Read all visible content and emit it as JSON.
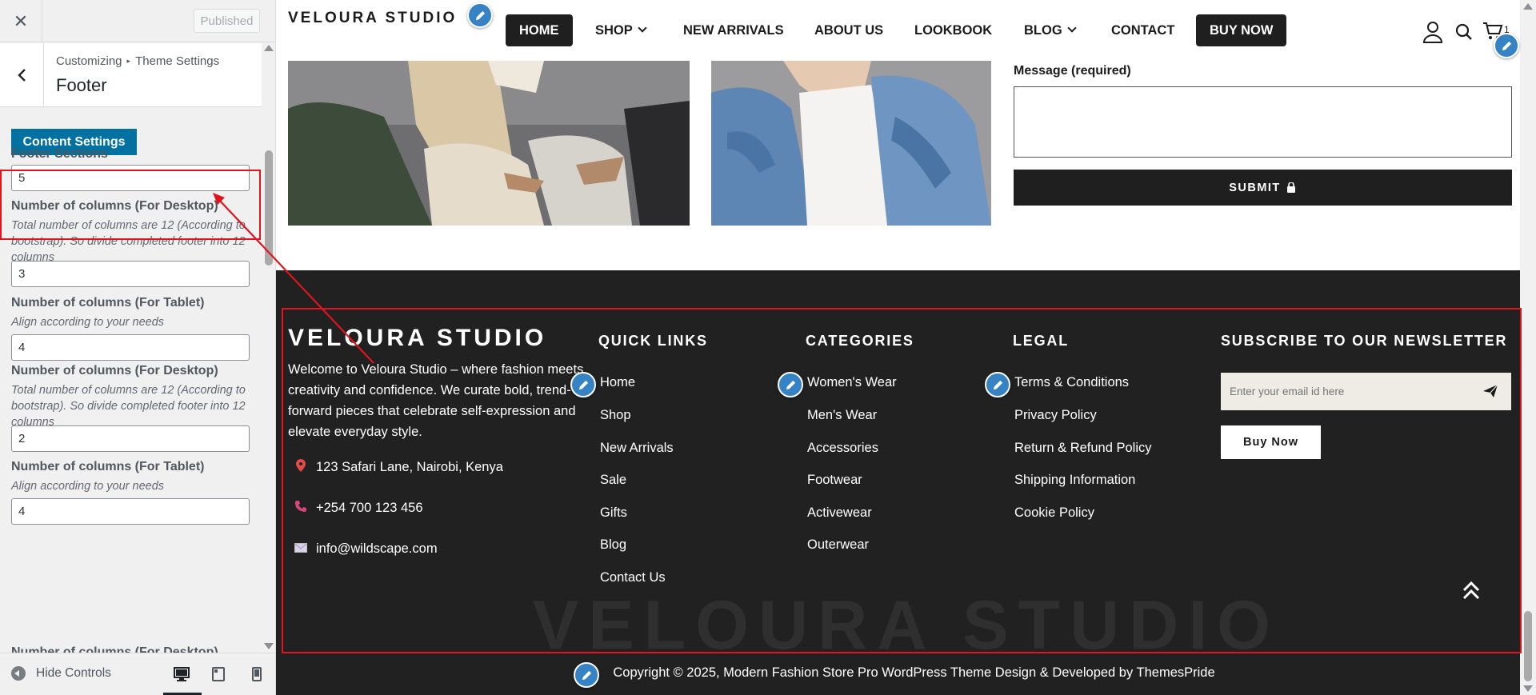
{
  "customizer": {
    "close_icon": "close-icon",
    "published_label": "Published",
    "breadcrumb_root": "Customizing",
    "breadcrumb_parent": "Theme Settings",
    "section_title": "Footer",
    "content_settings_label": "Content Settings",
    "fields": [
      {
        "label": "Footer Sections",
        "description": "",
        "value": "5"
      },
      {
        "label": "Number of columns (For Desktop)",
        "description": "Total number of columns are 12 (According to bootstrap). So divide completed footer into 12 columns",
        "value": "3"
      },
      {
        "label": "Number of columns (For Tablet)",
        "description": "Align according to your needs",
        "value": "4"
      },
      {
        "label": "Number of columns (For Desktop)",
        "description": "Total number of columns are 12 (According to bootstrap). So divide completed footer into 12 columns",
        "value": "2"
      },
      {
        "label": "Number of columns (For Tablet)",
        "description": "Align according to your needs",
        "value": "4"
      },
      {
        "label": "Number of columns (For Desktop)",
        "description": "",
        "value": ""
      }
    ],
    "hide_controls_label": "Hide Controls",
    "devices": [
      "desktop",
      "tablet",
      "mobile"
    ],
    "active_device": "desktop"
  },
  "site": {
    "logo": "VELOURA STUDIO",
    "nav": [
      {
        "label": "HOME",
        "dropdown": false,
        "active": true
      },
      {
        "label": "SHOP",
        "dropdown": true
      },
      {
        "label": "NEW ARRIVALS",
        "dropdown": false
      },
      {
        "label": "ABOUT US",
        "dropdown": false
      },
      {
        "label": "LOOKBOOK",
        "dropdown": false
      },
      {
        "label": "BLOG",
        "dropdown": true
      },
      {
        "label": "CONTACT",
        "dropdown": false
      }
    ],
    "buy_now": "BUY NOW",
    "cart_count": "1",
    "contact_form": {
      "message_label": "Message (required)",
      "submit_label": "SUBMIT"
    }
  },
  "footer": {
    "logo": "VELOURA STUDIO",
    "about": "Welcome to Veloura Studio – where fashion meets creativity and confidence. We curate bold, trend-forward pieces that celebrate self-expression and elevate everyday style.",
    "address": "123 Safari Lane, Nairobi, Kenya",
    "phone": "+254 700 123 456",
    "email": "info@wildscape.com",
    "quick_links": {
      "title": "QUICK LINKS",
      "items": [
        "Home",
        "Shop",
        "New Arrivals",
        "Sale",
        "Gifts",
        "Blog",
        "Contact Us"
      ]
    },
    "categories": {
      "title": "CATEGORIES",
      "items": [
        "Women's Wear",
        "Men's Wear",
        "Accessories",
        "Footwear",
        "Activewear",
        "Outerwear"
      ]
    },
    "legal": {
      "title": "LEGAL",
      "items": [
        "Terms & Conditions",
        "Privacy Policy",
        "Return & Refund Policy",
        "Shipping Information",
        "Cookie Policy"
      ]
    },
    "newsletter": {
      "title": "SUBSCRIBE TO OUR NEWSLETTER",
      "placeholder": "Enter your email id here",
      "button": "Buy Now"
    },
    "watermark": "VELOURA STUDIO",
    "copyright": "Copyright © 2025, Modern Fashion Store Pro WordPress Theme Design & Developed by ThemesPride"
  },
  "colors": {
    "accent_blue": "#0071a1",
    "pencil_blue": "#3582c4",
    "footer_bg": "#212121",
    "highlight_red": "#e0141e"
  }
}
